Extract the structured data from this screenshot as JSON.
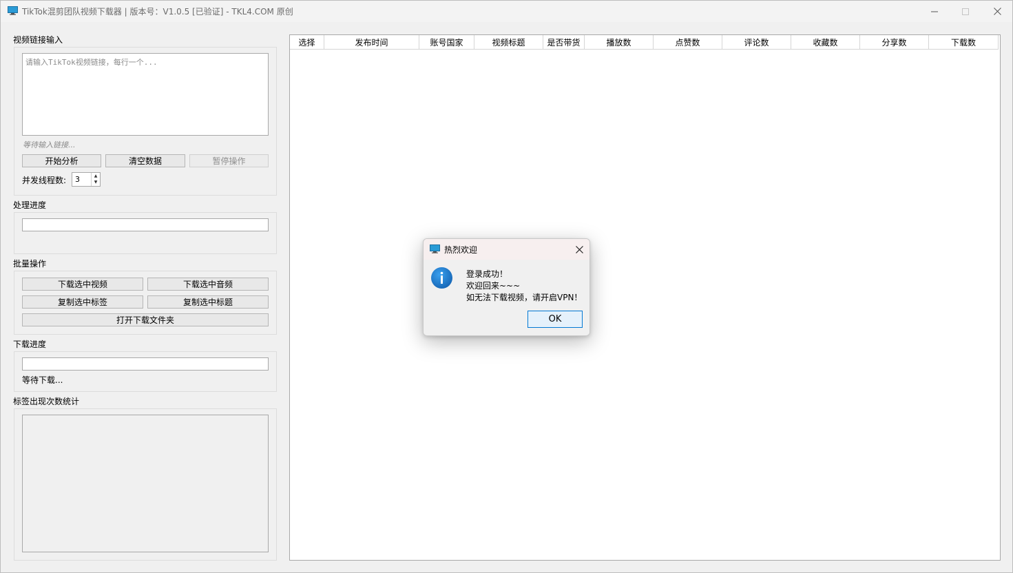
{
  "window": {
    "title": "TikTok混剪团队视频下载器 | 版本号：V1.0.5 [已验证] - TKL4.COM 原创",
    "app_icon": "monitor-icon",
    "controls": [
      "minimize-icon",
      "maximize-icon",
      "close-icon"
    ]
  },
  "input_section": {
    "label": "视频链接输入",
    "placeholder": "请输入TikTok视频链接，每行一个...",
    "status": "等待输入链接...",
    "buttons": {
      "start": "开始分析",
      "clear": "清空数据",
      "pause": "暂停操作"
    },
    "threads_label": "并发线程数:",
    "threads_value": "3"
  },
  "progress_section": {
    "label": "处理进度",
    "progress": 0
  },
  "batch_section": {
    "label": "批量操作",
    "buttons": {
      "download_video": "下载选中视频",
      "download_audio": "下载选中音频",
      "copy_tags": "复制选中标签",
      "copy_titles": "复制选中标题",
      "open_folder": "打开下载文件夹"
    }
  },
  "download_section": {
    "label": "下载进度",
    "progress": 0,
    "status": "等待下载..."
  },
  "tag_stats_section": {
    "label": "标签出现次数统计"
  },
  "table": {
    "columns": [
      "选择",
      "发布时间",
      "账号国家",
      "视频标题",
      "是否带货",
      "播放数",
      "点赞数",
      "评论数",
      "收藏数",
      "分享数",
      "下载数"
    ],
    "rows": []
  },
  "dialog": {
    "title": "热烈欢迎",
    "icon": "info-icon",
    "lines": [
      "登录成功！",
      "欢迎回来~~~",
      "如无法下载视频，请开启VPN！"
    ],
    "ok_label": "OK"
  },
  "colors": {
    "accent": "#0078d4",
    "info_blue": "#1a73c6",
    "window_bg": "#f0f0f0"
  }
}
